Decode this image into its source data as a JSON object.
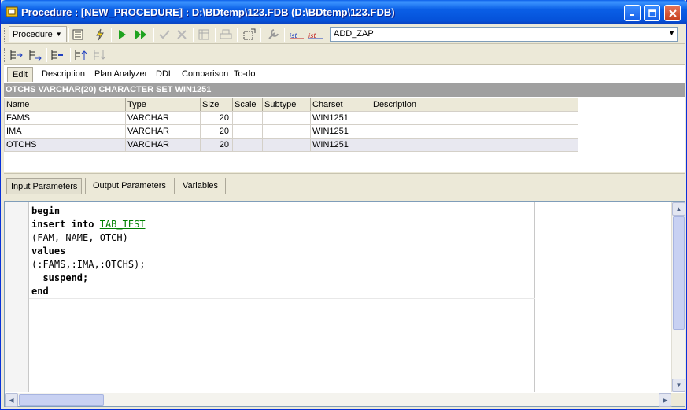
{
  "window": {
    "title": "Procedure : [NEW_PROCEDURE] : D:\\BDtemp\\123.FDB (D:\\BDtemp\\123.FDB)"
  },
  "toolbar": {
    "object_dropdown": "Procedure",
    "procedure_combo": "ADD_ZAP"
  },
  "tabs": [
    "Edit",
    "Description",
    "Plan Analyzer",
    "DDL",
    "Comparison",
    "To-do"
  ],
  "field_header": "OTCHS VARCHAR(20) CHARACTER SET WIN1251",
  "grid": {
    "columns": [
      "Name",
      "Type",
      "Size",
      "Scale",
      "Subtype",
      "Charset",
      "Description"
    ],
    "rows": [
      [
        "FAMS",
        "VARCHAR",
        "20",
        "",
        "",
        "WIN1251",
        ""
      ],
      [
        "IMA",
        "VARCHAR",
        "20",
        "",
        "",
        "WIN1251",
        ""
      ],
      [
        "OTCHS",
        "VARCHAR",
        "20",
        "",
        "",
        "WIN1251",
        ""
      ]
    ]
  },
  "param_tabs": [
    "Input Parameters",
    "Output Parameters",
    "Variables"
  ],
  "code": {
    "l1": "begin",
    "l2_kw": "insert into",
    "l2_link": "TAB_TEST",
    "l3": "(FAM, NAME, OTCH)",
    "l4": "values",
    "l5": "(:FAMS,:IMA,:OTCHS);",
    "l6": "  suspend;",
    "l7": "end"
  },
  "colors": {
    "title_bar": "#0a5fe6",
    "link": "#008000",
    "header_strip": "#a0a0a0"
  }
}
